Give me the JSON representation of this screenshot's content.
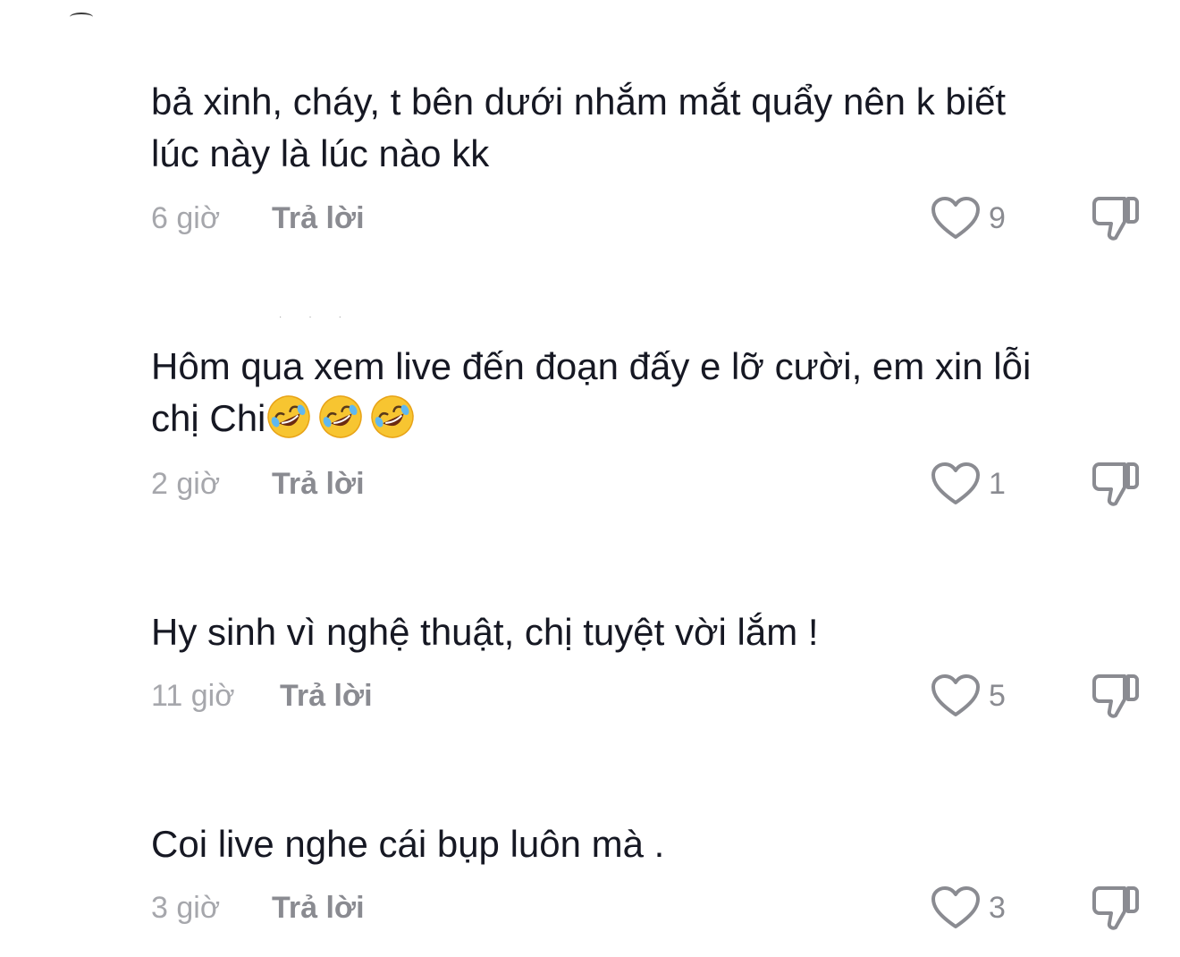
{
  "colors": {
    "text": "#161823",
    "meta": "#a6a7ac",
    "reply": "#8a8b91",
    "icon": "#8a8b91",
    "background": "#ffffff"
  },
  "comments": [
    {
      "text": "bả xinh, cháy, t bên dưới nhắm mắt quẩy nên k biết\nlúc này là lúc nào kk",
      "time": "6 giờ",
      "reply_label": "Trả lời",
      "likes": "9"
    },
    {
      "text": "Hôm qua xem live đến đoạn đấy e lỡ cười, em xin lỗi\nchị Chi",
      "emoji": [
        "rolling-on-floor-laughing",
        "rolling-on-floor-laughing",
        "rolling-on-floor-laughing"
      ],
      "time": "2 giờ",
      "reply_label": "Trả lời",
      "likes": "1"
    },
    {
      "text": "Hy sinh vì nghệ thuật, chị tuyệt vời lắm !",
      "time": "11 giờ",
      "reply_label": "Trả lời",
      "likes": "5"
    },
    {
      "text": "Coi live nghe cái bụp luôn mà .",
      "time": "3 giờ",
      "reply_label": "Trả lời",
      "likes": "3"
    }
  ],
  "icons": {
    "like": "heart-outline-icon",
    "dislike": "thumbs-down-outline-icon"
  }
}
